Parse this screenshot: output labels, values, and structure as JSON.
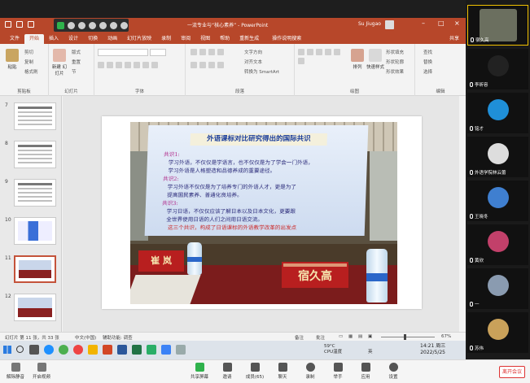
{
  "powerpoint": {
    "title": "一流专业与“核心素养”  -  PowerPoint",
    "user": "Su Jiugao",
    "share_label": "共享",
    "tabs": [
      "文件",
      "开始",
      "插入",
      "设计",
      "切换",
      "动画",
      "幻灯片放映",
      "录制",
      "审阅",
      "视图",
      "帮助",
      "重新生成"
    ],
    "active_tab": "开始",
    "tell_me": "操作说明搜索",
    "ribbon": {
      "paste": "粘贴",
      "clipboard_items": [
        "剪切",
        "复制",
        "格式刷"
      ],
      "clipboard_label": "剪贴板",
      "new_slide": "新建\n幻灯片",
      "slide_items": [
        "版式",
        "重置",
        "节"
      ],
      "slides_label": "幻灯片",
      "font_label": "字体",
      "paragraph_items": [
        "文字方向",
        "对齐文本",
        "转换为 SmartArt"
      ],
      "paragraph_label": "段落",
      "arrange": "排列",
      "quick_styles": "快速样式",
      "shape_items": [
        "形状填充",
        "形状轮廓",
        "形状效果"
      ],
      "drawing_label": "绘图",
      "edit_items": [
        "查找",
        "替换",
        "选择"
      ],
      "edit_label": "编辑"
    },
    "slides": [
      {
        "num": "7",
        "kind": "text"
      },
      {
        "num": "8",
        "kind": "text"
      },
      {
        "num": "9",
        "kind": "text"
      },
      {
        "num": "10",
        "kind": "chart"
      },
      {
        "num": "11",
        "kind": "photo"
      },
      {
        "num": "12",
        "kind": "photo"
      }
    ],
    "selected_slide": "11",
    "status": {
      "slide_count": "幻灯片 第 11 张，共 33 张",
      "language": "中文(中国)",
      "accessibility": "辅助功能: 调查",
      "notes": "备注",
      "comments": "批注",
      "zoom": "67%"
    }
  },
  "slide_photo": {
    "screen_title": "外语课标对比研究得出的国际共识",
    "lines": [
      {
        "text": "共识1:",
        "kind": "hl"
      },
      {
        "text": "学习外语，不仅仅是学语言，也不仅仅是为了学会一门外语，",
        "kind": "normal"
      },
      {
        "text": "学习外语是人格塑造和品德养成的重要途径。",
        "kind": "normal"
      },
      {
        "text": "共识2:",
        "kind": "hl"
      },
      {
        "text": "学习外语不仅仅是为了培养专门的外语人才，更是为了",
        "kind": "normal"
      },
      {
        "text": "提高国民素养、普通化良培养。",
        "kind": "normal"
      },
      {
        "text": "共识3:",
        "kind": "hl"
      },
      {
        "text": "学习日语，不仅仅应该了解日本以及日本文化，更要跟",
        "kind": "normal"
      },
      {
        "text": "全世界使用日语的人们之间用日语交流。",
        "kind": "normal"
      },
      {
        "text": "这三个共识，构成了日语课标的外语教学改革的出发点",
        "kind": "red"
      }
    ],
    "nameplate_left": "崔 岚",
    "nameplate_right": "宿久高"
  },
  "taskbar": {
    "weather": "59°C\nCPU温度",
    "ime": "英",
    "time": "14:21 周三",
    "date": "2022/5/25"
  },
  "participants": [
    {
      "name": "宿久高",
      "active": true,
      "avatar_color": "#6b6f5f"
    },
    {
      "name": "李昕容",
      "active": false,
      "avatar_color": "#222222"
    },
    {
      "name": "铭才",
      "active": false,
      "avatar_color": "#1f8fd8"
    },
    {
      "name": "外语学院林云蕾",
      "active": false,
      "avatar_color": "#dddddd"
    },
    {
      "name": "王晓冬",
      "active": false,
      "avatar_color": "#3f7fd0"
    },
    {
      "name": "黄欣",
      "active": false,
      "avatar_color": "#c2406a"
    },
    {
      "name": "一",
      "active": false,
      "avatar_color": "#8a9bb0"
    },
    {
      "name": "苏伟",
      "active": false,
      "avatar_color": "#c9a15a"
    }
  ],
  "meeting_toolbar": {
    "left": [
      "解除静音",
      "开启视频"
    ],
    "center": [
      "共享屏幕",
      "邀请",
      "成员(65)",
      "聊天",
      "录制",
      "举手",
      "应用",
      "设置"
    ],
    "leave": "离开会议"
  }
}
